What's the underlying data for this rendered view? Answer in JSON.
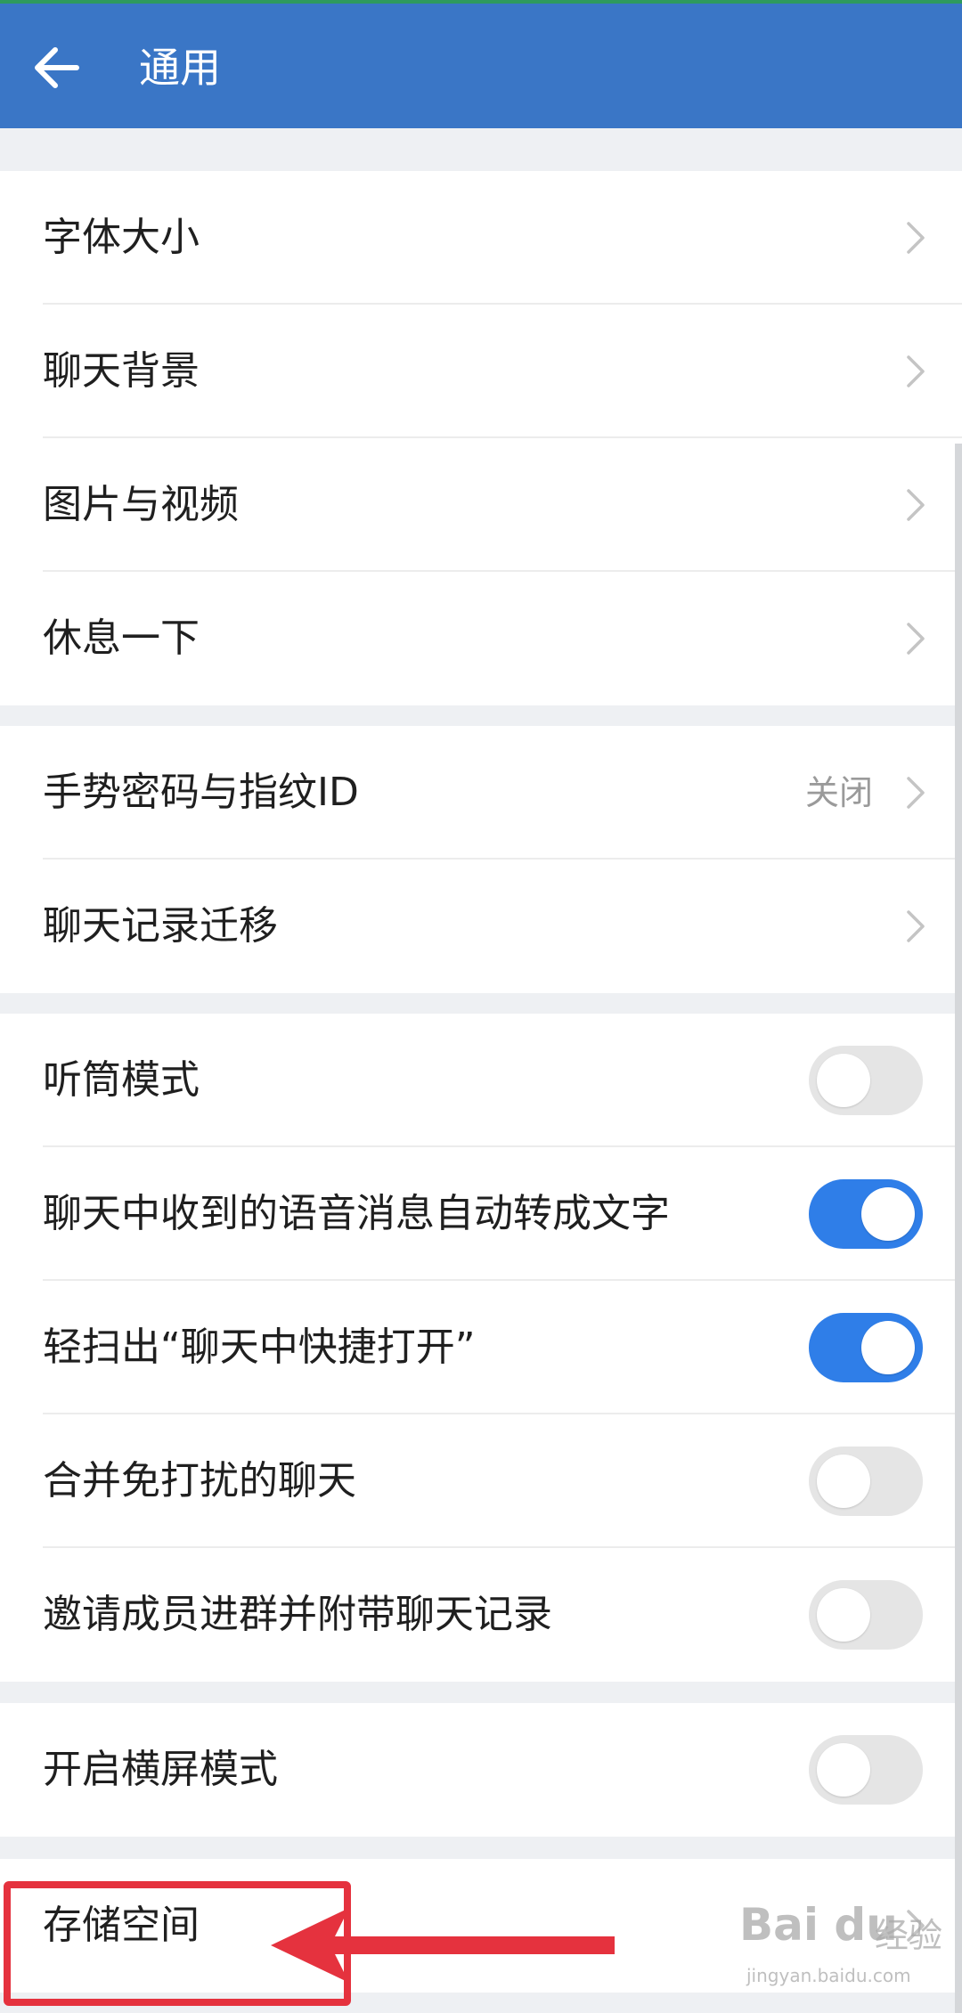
{
  "header": {
    "title": "通用",
    "back_icon": "arrow-left-icon"
  },
  "groups": [
    {
      "rows": [
        {
          "label": "字体大小",
          "type": "chevron"
        },
        {
          "label": "聊天背景",
          "type": "chevron"
        },
        {
          "label": "图片与视频",
          "type": "chevron"
        },
        {
          "label": "休息一下",
          "type": "chevron"
        }
      ]
    },
    {
      "rows": [
        {
          "label": "手势密码与指纹ID",
          "type": "chevron",
          "value": "关闭"
        },
        {
          "label": "聊天记录迁移",
          "type": "chevron"
        }
      ]
    },
    {
      "rows": [
        {
          "label": "听筒模式",
          "type": "toggle",
          "on": false
        },
        {
          "label": "聊天中收到的语音消息自动转成文字",
          "type": "toggle",
          "on": true
        },
        {
          "label": "轻扫出“聊天中快捷打开”",
          "type": "toggle",
          "on": true
        },
        {
          "label": "合并免打扰的聊天",
          "type": "toggle",
          "on": false
        },
        {
          "label": "邀请成员进群并附带聊天记录",
          "type": "toggle",
          "on": false
        }
      ]
    },
    {
      "rows": [
        {
          "label": "开启横屏模式",
          "type": "toggle",
          "on": false
        }
      ]
    },
    {
      "rows": [
        {
          "label": "存储空间",
          "type": "chevron"
        }
      ]
    }
  ],
  "annotation": {
    "highlight_color": "#e5323e",
    "target": "存储空间"
  },
  "watermark": {
    "logo": "Bai du",
    "text": "经验",
    "url": "jingyan.baidu.com"
  },
  "colors": {
    "header": "#3a76c6",
    "toggle_on": "#2f7ee8",
    "toggle_off": "#e5e5e5",
    "background": "#eef0f3"
  }
}
